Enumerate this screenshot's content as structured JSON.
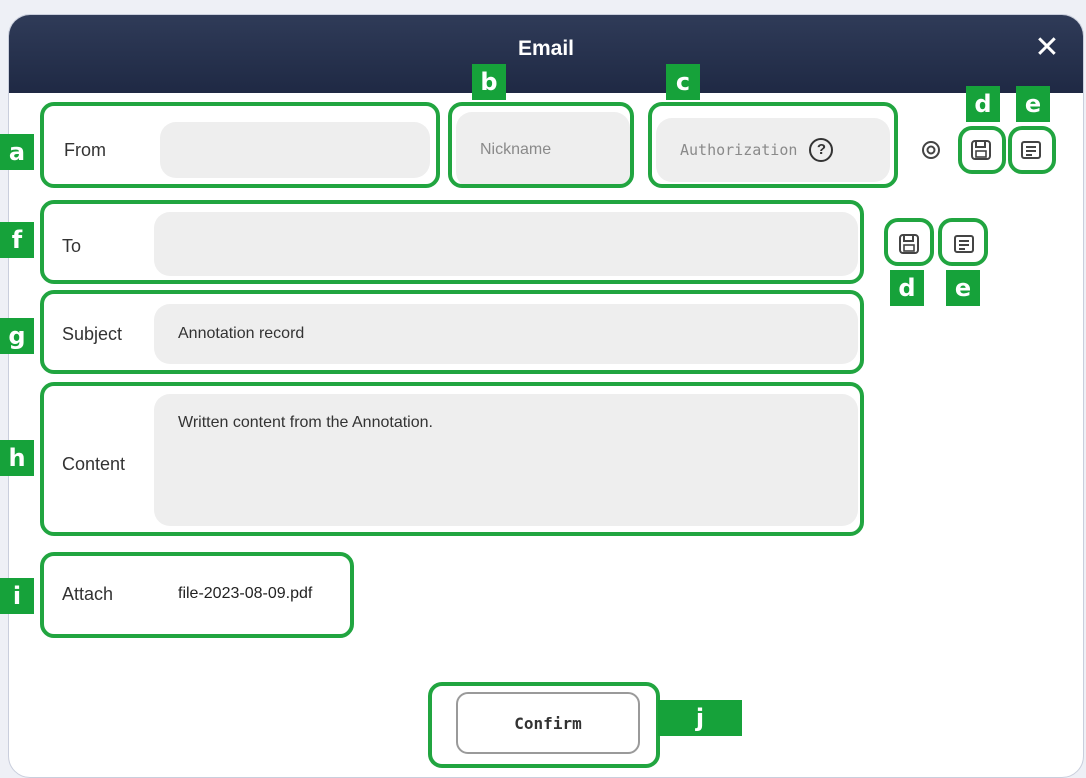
{
  "dialog": {
    "title": "Email",
    "close_label": "✕"
  },
  "from": {
    "label": "From",
    "value": "",
    "nickname_placeholder": "Nickname",
    "authorization_placeholder": "Authorization",
    "help_glyph": "?"
  },
  "to": {
    "label": "To",
    "value": ""
  },
  "subject": {
    "label": "Subject",
    "value": "Annotation record"
  },
  "content": {
    "label": "Content",
    "value": "Written content from the Annotation."
  },
  "attach": {
    "label": "Attach",
    "file": "file-2023-08-09.pdf"
  },
  "actions": {
    "confirm_label": "Confirm"
  },
  "badges": {
    "a": "a",
    "b": "b",
    "c": "c",
    "d": "d",
    "e": "e",
    "f": "f",
    "g": "g",
    "h": "h",
    "i": "i",
    "j": "j"
  },
  "icons": {
    "settings": "settings-icon",
    "save": "save-icon",
    "contacts": "contact-list-icon"
  },
  "colors": {
    "annotation_green": "#21a540",
    "titlebar": "#24304d",
    "field_bg": "#eeeeee"
  }
}
